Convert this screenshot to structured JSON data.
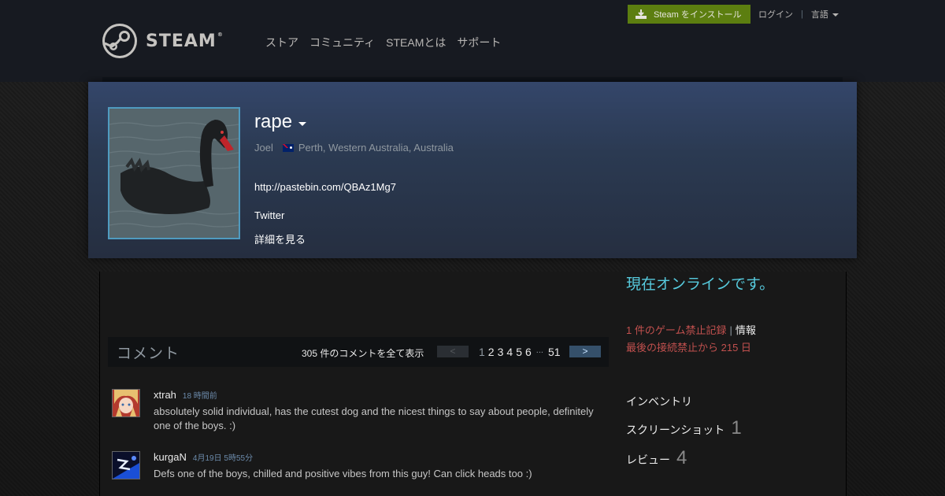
{
  "header": {
    "logo_text": "STEAM",
    "logo_reg": "®",
    "nav": [
      "ストア",
      "コミュニティ",
      "STEAMとは",
      "サポート"
    ],
    "install_label": "Steam をインストール",
    "login_label": "ログイン",
    "separator": "|",
    "language_label": "言語"
  },
  "profile": {
    "persona_name": "rape",
    "real_name": "Joel",
    "location": "Perth, Western Australia, Australia",
    "summary_lines": [
      "http://pastebin.com/QBAz1Mg7",
      "Twitter"
    ],
    "more_info_label": "詳細を見る"
  },
  "comments": {
    "title": "コメント",
    "view_all_label": "305 件のコメントを全て表示",
    "pagination": {
      "prev_label": "<",
      "next_label": ">",
      "current_page": "1",
      "pages": [
        "2",
        "3",
        "4",
        "5",
        "6"
      ],
      "ellipsis": "...",
      "last_page": "51"
    },
    "items": [
      {
        "author": "xtrah",
        "time": "18 時間前",
        "text": "absolutely solid individual, has the cutest dog and the nicest things to say about people, definitely one of the boys. :)"
      },
      {
        "author": "kurgaN",
        "time": "4月19日 5時55分",
        "text": "Defs one of the boys, chilled and positive vibes from this guy! Can click heads too :)"
      }
    ]
  },
  "sidebar": {
    "online_status": "現在オンラインです。",
    "ban_record": "1 件のゲーム禁止記録",
    "ban_divider": "|",
    "ban_info": "情報",
    "ban_days": "最後の接続禁止から 215 日",
    "links": [
      {
        "label": "インベントリ",
        "count": ""
      },
      {
        "label": "スクリーンショット",
        "count": "1"
      },
      {
        "label": "レビュー",
        "count": "4"
      }
    ]
  },
  "colors": {
    "accent_online": "#57cbde",
    "ban_red": "#c1504e",
    "install_green": "#5c7e10"
  }
}
